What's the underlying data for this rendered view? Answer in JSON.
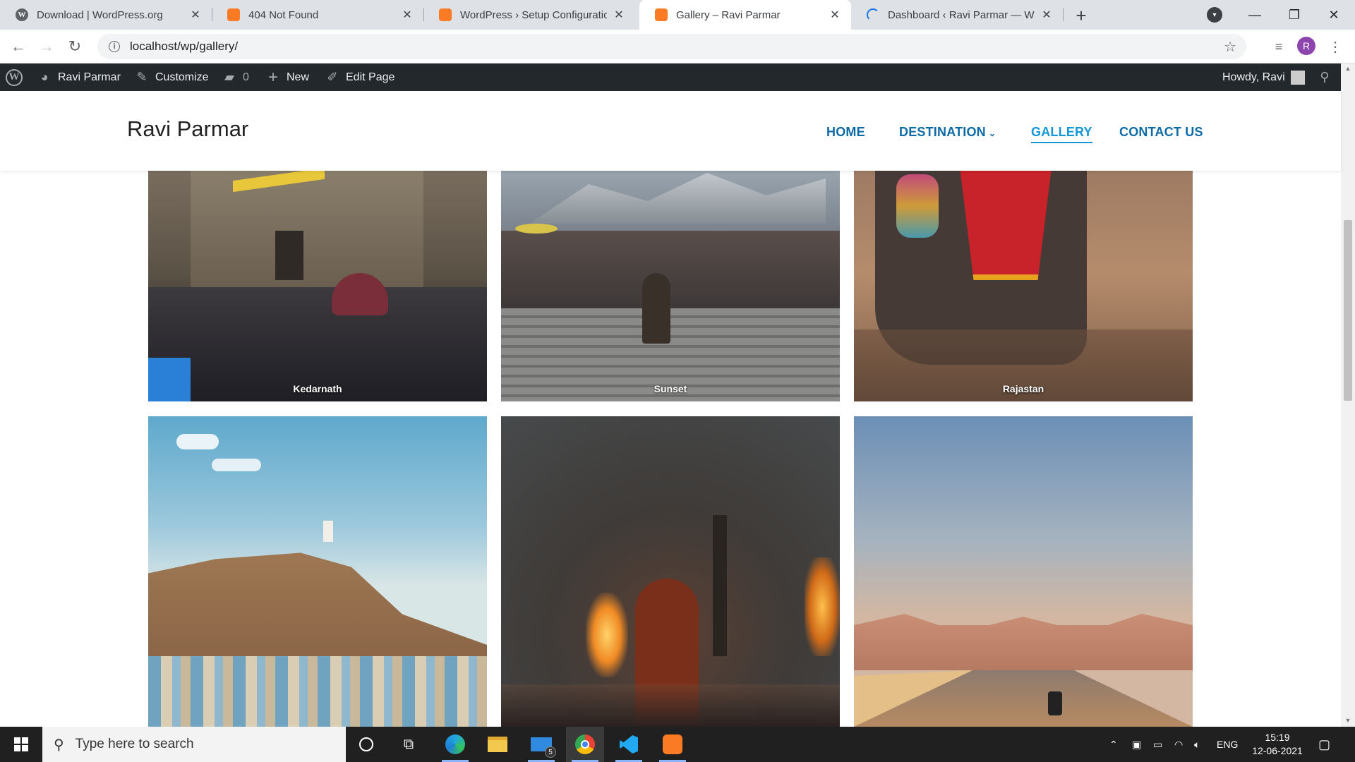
{
  "browser": {
    "tabs": [
      {
        "title": "Download | WordPress.org",
        "favicon": "wordpress-favicon"
      },
      {
        "title": "404 Not Found",
        "favicon": "xampp-favicon"
      },
      {
        "title": "WordPress › Setup Configuration",
        "favicon": "xampp-favicon"
      },
      {
        "title": "Gallery – Ravi Parmar",
        "favicon": "xampp-favicon",
        "active": true
      },
      {
        "title": "Dashboard ‹ Ravi Parmar — Wor",
        "favicon": "loading-spinner"
      }
    ],
    "url": "localhost/wp/gallery/",
    "profile_initial": "R"
  },
  "admin_bar": {
    "site_name": "Ravi Parmar",
    "customize": "Customize",
    "comments_count": "0",
    "new": "New",
    "edit_page": "Edit Page",
    "greeting": "Howdy, Ravi"
  },
  "site": {
    "title": "Ravi Parmar",
    "nav": [
      {
        "label": "HOME"
      },
      {
        "label": "DESTINATION",
        "has_submenu": true
      },
      {
        "label": "GALLERY",
        "current": true
      },
      {
        "label": "CONTACT US"
      }
    ]
  },
  "gallery": {
    "items": [
      {
        "caption": "Kedarnath"
      },
      {
        "caption": "Sunset"
      },
      {
        "caption": "Rajastan"
      },
      {
        "caption": ""
      },
      {
        "caption": ""
      },
      {
        "caption": ""
      }
    ]
  },
  "taskbar": {
    "search_placeholder": "Type here to search",
    "mail_badge": "5",
    "language": "ENG",
    "time": "15:19",
    "date": "12-06-2021"
  },
  "colors": {
    "admin_bar": "#23282d",
    "nav_link": "#0c6ba6",
    "nav_current": "#1497d6",
    "taskbar": "#202020"
  }
}
